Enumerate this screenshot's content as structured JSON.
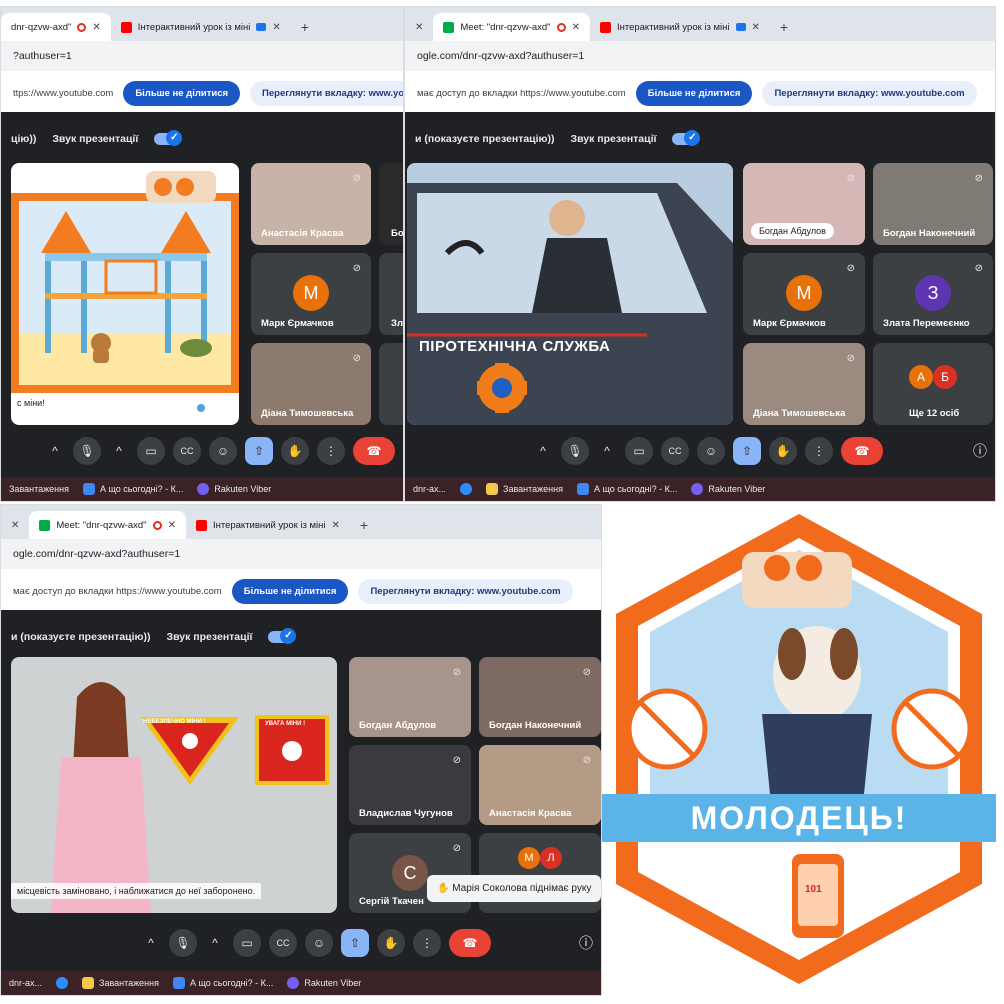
{
  "tabs": {
    "meet_title": "Meet: \"dnr-qzvw-axd\"",
    "meet_title_short": "dnr-qzvw-axd\"",
    "youtube_title": "Інтерактивний урок із міні",
    "plus": "+",
    "close": "✕"
  },
  "address": {
    "p1": "?authuser=1",
    "p2": "ogle.com/dnr-qzvw-axd?authuser=1",
    "p3": "ogle.com/dnr-qzvw-axd?authuser=1"
  },
  "share": {
    "text_p1": "ttps://www.youtube.com",
    "text_p2": "має доступ до вкладки https://www.youtube.com",
    "stop_label": "Більше не ділитися",
    "view_label": "Переглянути вкладку: www.youtube.com",
    "view_label_short": "Переглянути вкладку: www.youtube.co"
  },
  "meetbar": {
    "presenting_p1": "цію))",
    "presenting_p2": "и (показуєте презентацію))",
    "presentation_sound": "Звук презентації"
  },
  "participants": {
    "anastasia": "Анастасія Красва",
    "mark": "Марк Єрмачков",
    "diana": "Діана Тимошевська",
    "bogdan_a": "Богдан Абдулов",
    "bogdan_n": "Богдан Наконечний",
    "zlata": "Злата Перемєєнко",
    "more": "Ще 12 осіб",
    "vladyslav": "Владислав Чугунов",
    "sergiy": "Сергій Ткачен",
    "partial_b": "Бо",
    "partial_z": "Зл"
  },
  "avatars": {
    "m": "М",
    "z": "З",
    "a": "А",
    "b": "Б",
    "s": "С",
    "md": "М",
    "l": "Л"
  },
  "avatar_colors": {
    "mark": "#e8710a",
    "zlata": "#5e35b1",
    "a": "#e8710a",
    "b": "#d93025",
    "sergiy": "#795548"
  },
  "slides": {
    "p1_caption": "с міни!",
    "p2_service": "ПІРОТЕХНІЧНА СЛУЖБА",
    "p3_sign1": "НЕБЕЗПЕЧНО МІНИ !",
    "p3_sign2": "УВАГА МІНИ !",
    "p3_caption": "місцевість заміновано, і наближатися до неї заборонено."
  },
  "toast": {
    "hand_raised": "Марія Соколова піднімає руку"
  },
  "controls": {
    "chevron": "^",
    "mic": "🎙",
    "cam": "▭",
    "cc": "CC",
    "emoji": "☺",
    "present": "⇧",
    "hand": "✋",
    "more": "⋮",
    "end": "☎",
    "info": "ⓘ"
  },
  "taskbar": {
    "loading": "Завантаження",
    "what_today": "А що сьогодні? - К...",
    "viber": "Rakuten Viber",
    "meet_ax": "dnr-ax..."
  },
  "badge": {
    "text": "МОЛОДЕЦЬ!",
    "number": "101"
  },
  "colors": {
    "accent_blue": "#1a56c4",
    "meet_dark": "#202124",
    "tile": "#3c4043",
    "end_red": "#ea4335",
    "badge_orange": "#f26b1d",
    "badge_sky": "#b9dcf3",
    "badge_ribbon": "#5bb4e8"
  }
}
